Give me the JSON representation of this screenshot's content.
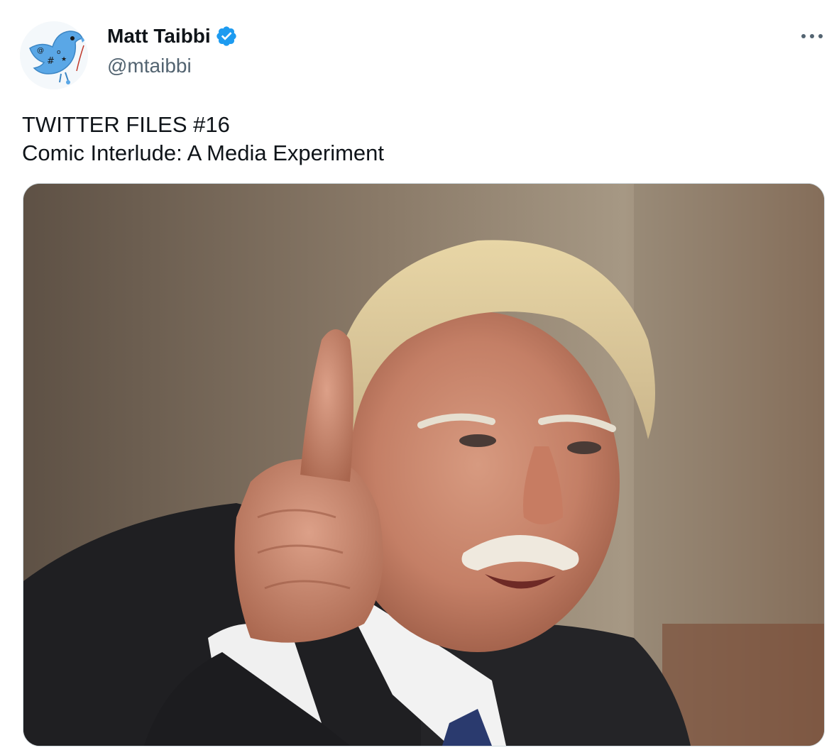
{
  "tweet": {
    "author": {
      "display_name": "Matt Taibbi",
      "handle": "@mtaibbi",
      "verified": true,
      "avatar_icon": "twitter-bird-doodle-icon"
    },
    "more_icon": "more-horizontal-icon",
    "text_lines": [
      "TWITTER FILES #16",
      "Comic Interlude: A Media Experiment"
    ],
    "media": {
      "type": "photo",
      "alt": ""
    }
  },
  "colors": {
    "text_primary": "#0f1419",
    "text_secondary": "#536471",
    "verified_blue": "#1d9bf0",
    "border": "#cfd9de"
  }
}
